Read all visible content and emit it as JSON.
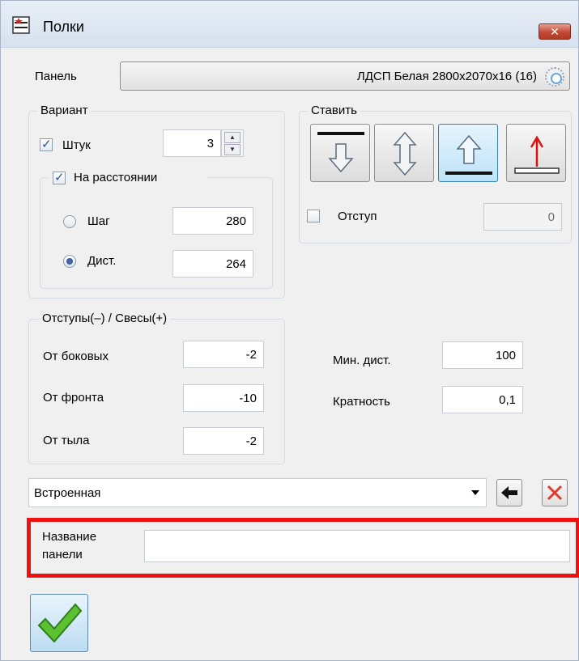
{
  "window": {
    "title": "Полки",
    "close_label": "✕"
  },
  "panel": {
    "label": "Панель",
    "value": "ЛДСП Белая 2800x2070x16 (16)"
  },
  "variant": {
    "title": "Вариант",
    "count_label": "Штук",
    "count_value": "3",
    "count_checked": true,
    "distance_group_label": "На расстоянии",
    "distance_checked": true,
    "step_label": "Шаг",
    "step_value": "280",
    "dist_label": "Дист.",
    "dist_value": "264",
    "selected_mode": "Дист."
  },
  "place": {
    "title": "Ставить",
    "selected_index": 2,
    "offset_label": "Отступ",
    "offset_checked": false,
    "offset_value": "0"
  },
  "offsets": {
    "title": "Отступы(–) / Свесы(+)",
    "side_label": "От боковых",
    "side_value": "-2",
    "front_label": "От фронта",
    "front_value": "-10",
    "back_label": "От тыла",
    "back_value": "-2"
  },
  "min_dist": {
    "label": "Мин. дист.",
    "value": "100"
  },
  "multiplicity": {
    "label": "Кратность",
    "value": "0,1"
  },
  "type_select": {
    "value": "Встроенная"
  },
  "panel_name": {
    "label_line1": "Название",
    "label_line2": "панели",
    "value": ""
  },
  "colors": {
    "highlight": "#ee1111",
    "accent": "#3c7fb1",
    "ok_green": "#5cc130"
  }
}
